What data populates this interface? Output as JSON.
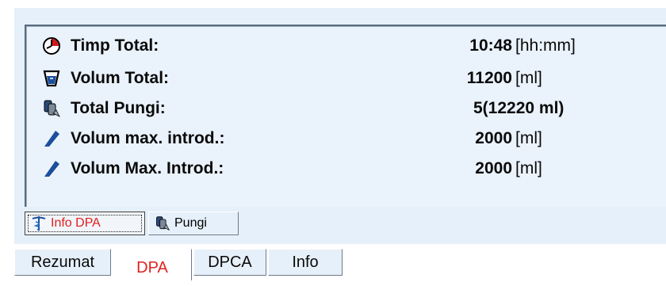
{
  "summary": {
    "rows": [
      {
        "icon": "clock-icon",
        "label": "Timp Total:",
        "value": "10:48",
        "unit": "[hh:mm]"
      },
      {
        "icon": "volume-cup-icon",
        "label": "Volum Total:",
        "value": "11200",
        "unit": "[ml]"
      },
      {
        "icon": "bags-icon",
        "label": "Total Pungi:",
        "value": "5(12220 ml)",
        "unit": ""
      },
      {
        "icon": "infusion-icon",
        "label": "Volum max. introd.:",
        "value": "2000",
        "unit": "[ml]"
      },
      {
        "icon": "infusion-icon",
        "label": "Volum Max. Introd.:",
        "value": "2000",
        "unit": "[ml]"
      }
    ]
  },
  "subtabs": [
    {
      "label": "Info DPA",
      "icon": "caduceus-icon",
      "active": true
    },
    {
      "label": "Pungi",
      "icon": "bags-icon",
      "active": false
    }
  ],
  "tabs": [
    {
      "label": "Rezumat",
      "active": false
    },
    {
      "label": "DPA",
      "active": true
    },
    {
      "label": "DPCA",
      "active": false
    },
    {
      "label": "Info",
      "active": false
    }
  ],
  "colors": {
    "panel_bg": "#eaf2fb",
    "active_tab_text": "#e02020",
    "icon_blue": "#1a4f9c"
  }
}
